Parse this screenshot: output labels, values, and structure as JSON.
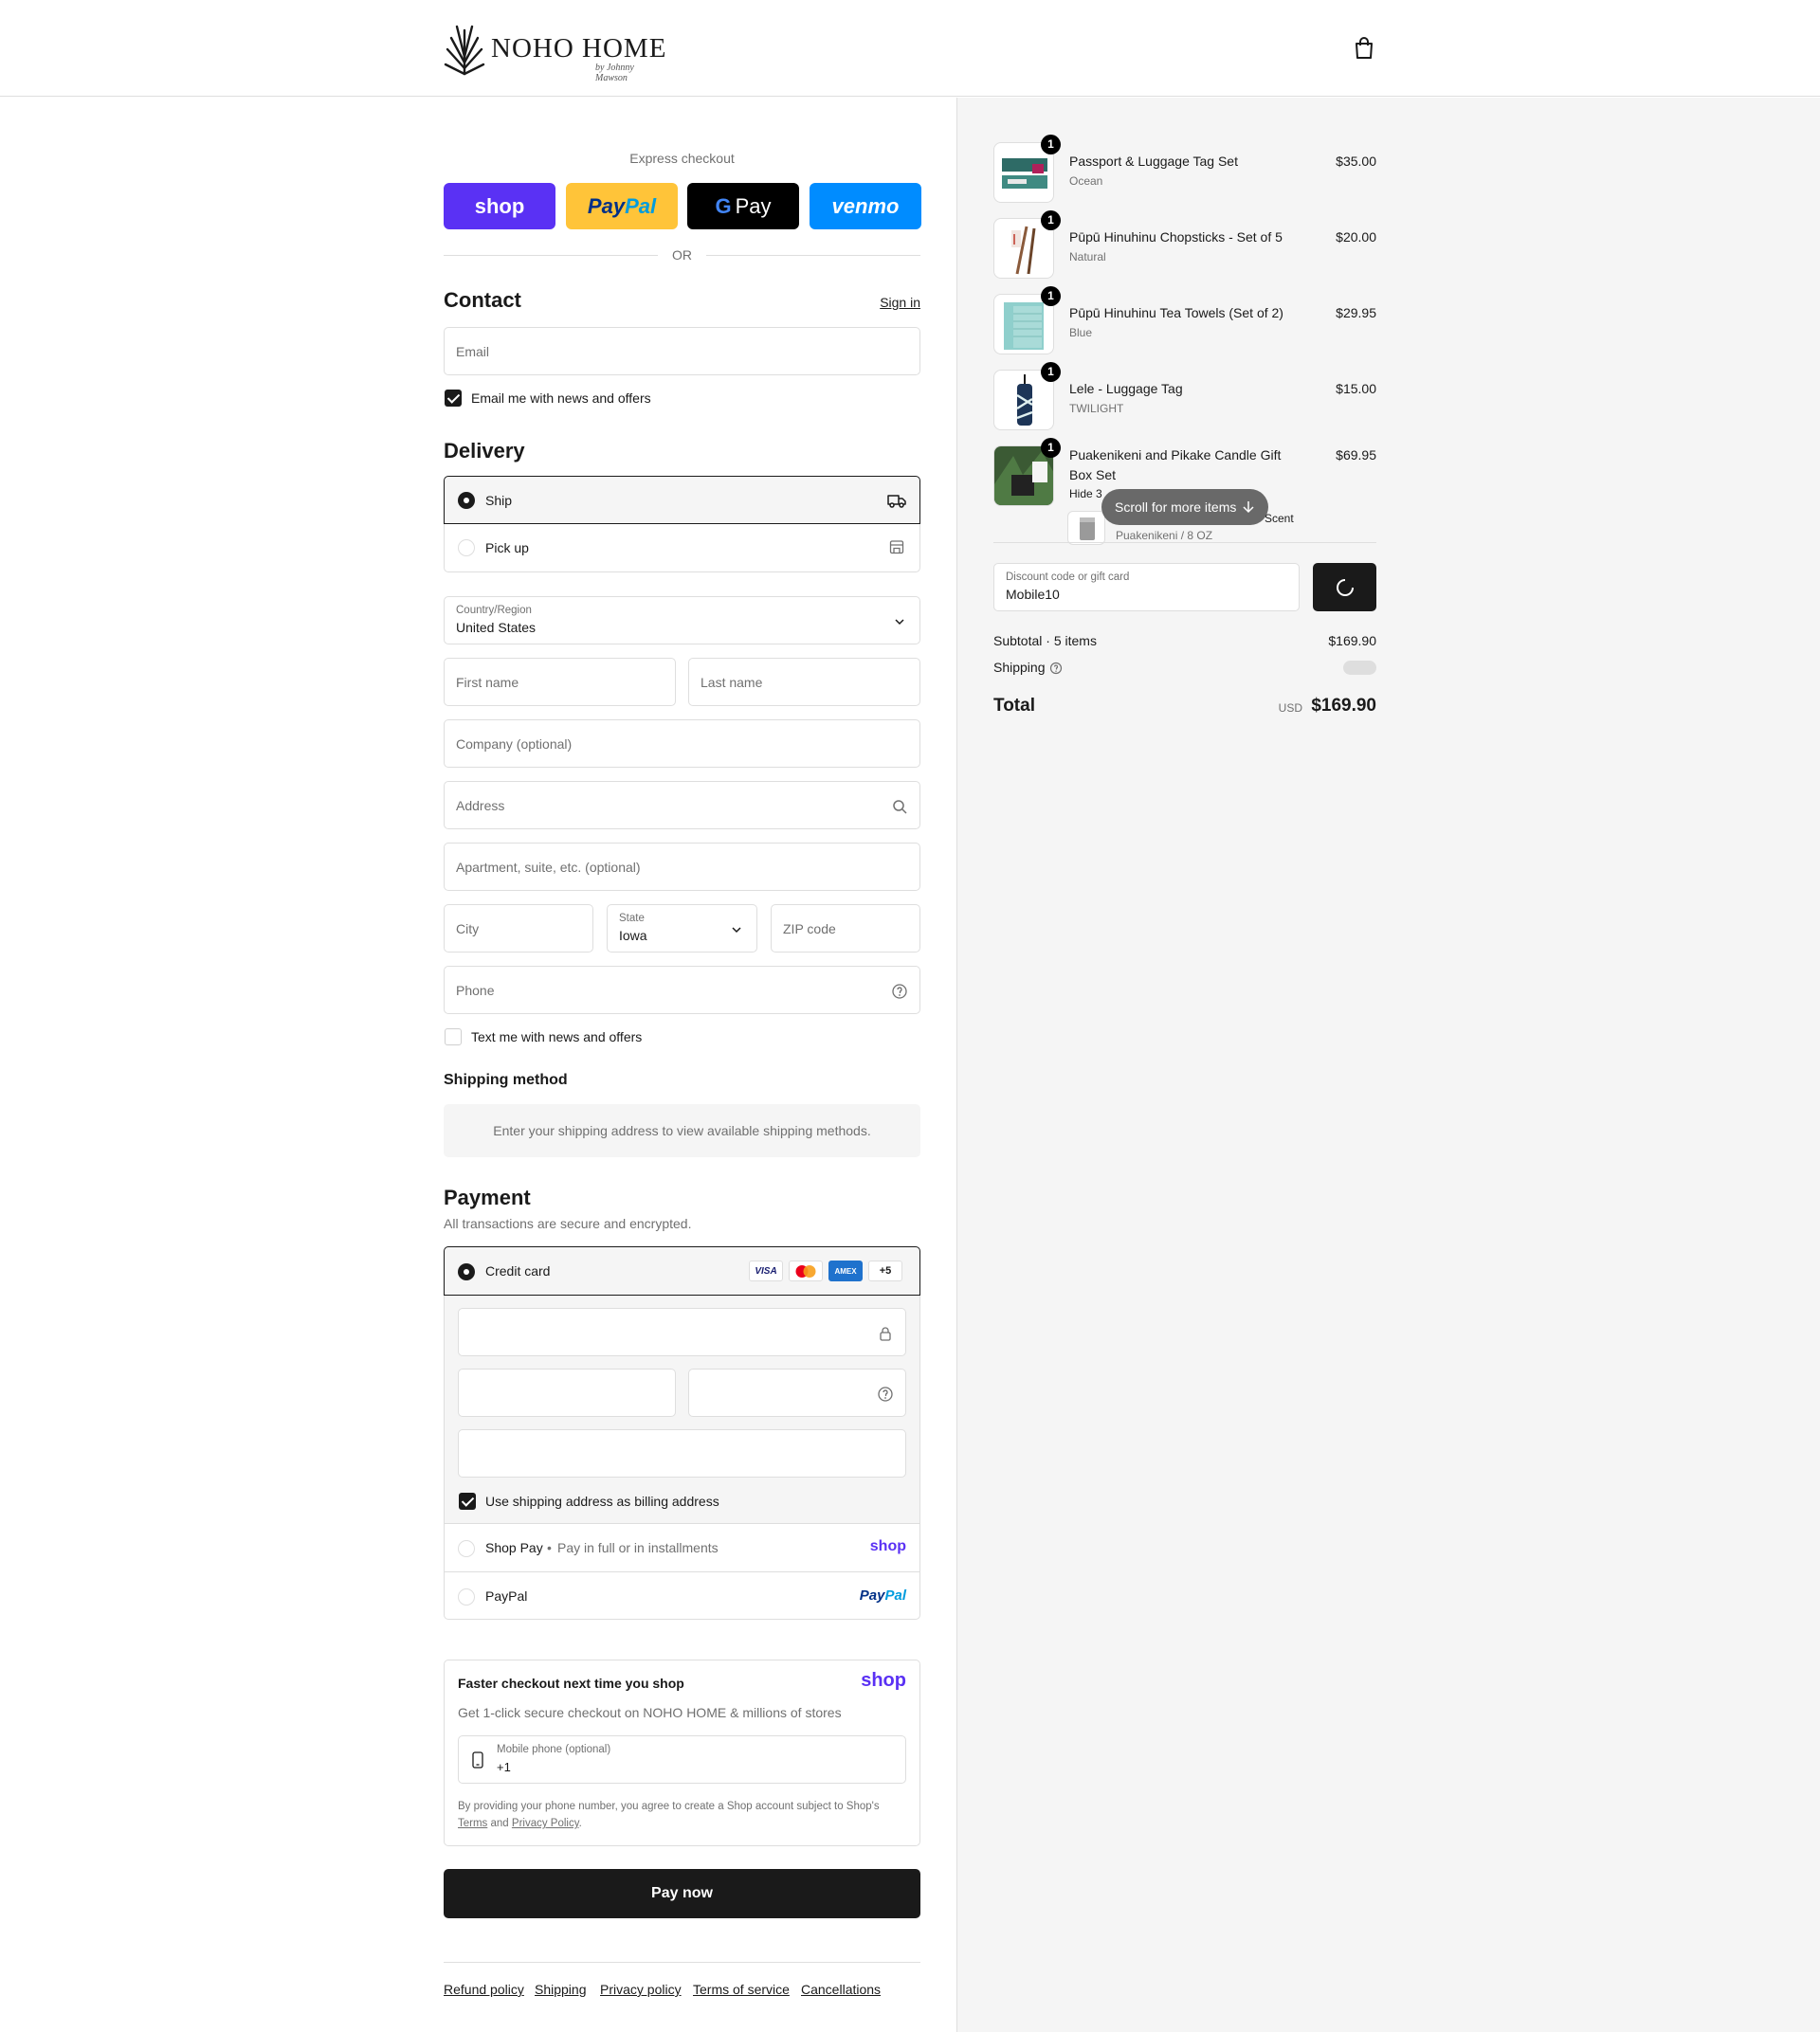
{
  "header": {
    "brand": "NOHO HOME",
    "brand_sub": "by Johnny Mawson"
  },
  "express": {
    "label": "Express checkout",
    "shop": "shop",
    "paypal_a": "Pay",
    "paypal_b": "Pal",
    "gpay_g": "G",
    "gpay": "Pay",
    "venmo": "venmo",
    "or": "OR"
  },
  "contact": {
    "title": "Contact",
    "sign_in": "Sign in",
    "email_placeholder": "Email",
    "news_checkbox": "Email me with news and offers",
    "news_checked": true
  },
  "delivery": {
    "title": "Delivery",
    "ship": "Ship",
    "pickup": "Pick up",
    "selected": "Ship",
    "country_label": "Country/Region",
    "country_value": "United States",
    "first_name": "First name",
    "last_name": "Last name",
    "company": "Company (optional)",
    "address": "Address",
    "apartment": "Apartment, suite, etc. (optional)",
    "city": "City",
    "state_label": "State",
    "state_value": "Iowa",
    "zip": "ZIP code",
    "phone": "Phone",
    "text_checkbox": "Text me with news and offers",
    "text_checked": false
  },
  "shipping_method": {
    "title": "Shipping method",
    "note": "Enter your shipping address to view available shipping methods."
  },
  "payment": {
    "title": "Payment",
    "subtitle": "All transactions are secure and encrypted.",
    "credit_card": "Credit card",
    "cards": [
      "VISA",
      "AMEX",
      "+5"
    ],
    "billing_checkbox": "Use shipping address as billing address",
    "billing_checked": true,
    "shop_pay": "Shop Pay",
    "shop_pay_note": "Pay in full or in installments",
    "shop_logo": "shop",
    "paypal": "PayPal",
    "paypal_logo_a": "Pay",
    "paypal_logo_b": "Pal"
  },
  "faster": {
    "title": "Faster checkout next time you shop",
    "shop_logo": "shop",
    "subtitle": "Get 1-click secure checkout on NOHO HOME & millions of stores",
    "phone_label": "Mobile phone (optional)",
    "phone_value": "+1",
    "legal_a": "By providing your phone number, you agree to create a Shop account subject to Shop's",
    "legal_terms": "Terms",
    "legal_and": "and",
    "legal_privacy": "Privacy Policy",
    "legal_end": "."
  },
  "pay_now": "Pay now",
  "footer_links": [
    "Refund policy",
    "Shipping",
    "Privacy policy",
    "Terms of service",
    "Cancellations"
  ],
  "order": {
    "items": [
      {
        "name": "Passport & Luggage Tag Set",
        "variant": "Ocean",
        "price": "$35.00",
        "qty": "1"
      },
      {
        "name": "Pūpū Hinuhinu Chopsticks - Set of 5",
        "variant": "Natural",
        "price": "$20.00",
        "qty": "1"
      },
      {
        "name": "Pūpū Hinuhinu Tea Towels (Set of 2)",
        "variant": "Blue",
        "price": "$29.95",
        "qty": "1"
      },
      {
        "name": "Lele - Luggage Tag",
        "variant": "TWILIGHT",
        "price": "$15.00",
        "qty": "1"
      },
      {
        "name": "Puakenikeni and Pikake Candle Gift Box Set",
        "variant": "Hide 3",
        "price": "$69.95",
        "qty": "1"
      }
    ],
    "sub_item_tail": "Scent",
    "sub_item_variant": "Puakenikeni / 8 OZ",
    "scroll_pill": "Scroll for more items",
    "discount_label": "Discount code or gift card",
    "discount_value": "Mobile10",
    "subtotal_label": "Subtotal · 5 items",
    "subtotal_value": "$169.90",
    "shipping_label": "Shipping",
    "total_label": "Total",
    "total_currency": "USD",
    "total_value": "$169.90"
  },
  "colors": {
    "shop_purple": "#5a31f4",
    "paypal_yellow": "#ffc439",
    "venmo_blue": "#008cff",
    "dark": "#1a1a1a"
  }
}
